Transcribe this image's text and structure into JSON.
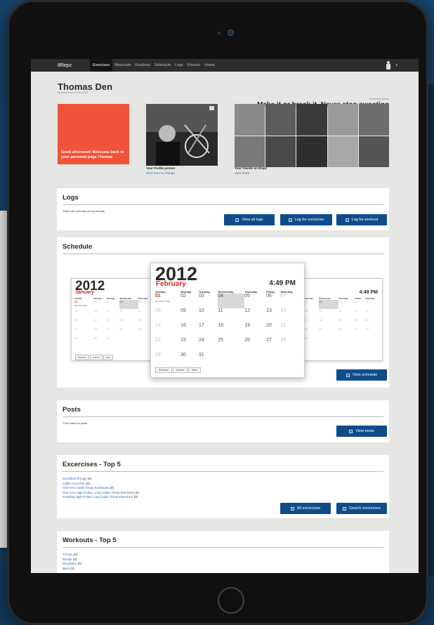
{
  "app": {
    "brand": "8Repz"
  },
  "nav": [
    "Exercises",
    "Workouts",
    "Routines",
    "Schedule",
    "Logs",
    "Friends",
    "Home"
  ],
  "nav_active": "Exercises",
  "profile": {
    "name": "Thomas Den",
    "since": "Member Since 12 Dec 2012",
    "quote_label": "Personal Quote",
    "quote": "Make it or break it. Never stop sweating"
  },
  "welcome": "Good afternoon! Welcome back to your personal page Thomas",
  "profile_pic": {
    "caption": "Your Profile picture",
    "link": "Click here to change"
  },
  "friends": {
    "caption": "Your friends on 8repz",
    "link": "View more"
  },
  "logs": {
    "title": "Logs",
    "text": "There are currently no log records",
    "btn_view": "View all logs",
    "btn_exercise": "Log for excercise",
    "btn_workout": "Log for workout"
  },
  "schedule": {
    "title": "Schedule",
    "btn_view": "View schedule",
    "front": {
      "year": "2012",
      "month": "February",
      "time": "4:49 PM",
      "days": [
        "Sunday",
        "Monday",
        "Tuesday",
        "Wednesday",
        "Thursday",
        "Friday",
        "Saturday"
      ],
      "note": "New Year's Day",
      "nav": [
        "Previous",
        "Current",
        "Next"
      ],
      "weeks": [
        [
          "01",
          "02",
          "03",
          "04",
          "05",
          "06",
          "07"
        ],
        [
          "08",
          "09",
          "10",
          "11",
          "12",
          "13",
          "14"
        ],
        [
          "15",
          "16",
          "17",
          "18",
          "19",
          "20",
          "21"
        ],
        [
          "22",
          "23",
          "24",
          "25",
          "26",
          "27",
          "28"
        ],
        [
          "29",
          "30",
          "31",
          "",
          "",
          "",
          ""
        ]
      ]
    },
    "left": {
      "year": "2012",
      "month": "January",
      "days": [
        "Sunday",
        "Monday",
        "Tuesday",
        "Wednesday",
        "Thursday"
      ],
      "note": "New Year's Day",
      "nav": [
        "Previous",
        "Current",
        "Next"
      ],
      "weeks": [
        [
          "01",
          "02",
          "03",
          "04",
          "05"
        ],
        [
          "08",
          "09",
          "10",
          "11",
          "12"
        ],
        [
          "15",
          "16",
          "17",
          "18",
          "19"
        ],
        [
          "22",
          "23",
          "24",
          "25",
          "26"
        ],
        [
          "29",
          "30",
          "31",
          "",
          ""
        ]
      ]
    },
    "right": {
      "year": "2",
      "time": "4:49 PM",
      "days": [
        "Tuesday",
        "Wednesday",
        "Thursday",
        "Friday",
        "Saturday"
      ],
      "weeks": [
        [
          "03",
          "04",
          "05",
          "06",
          "07"
        ],
        [
          "10",
          "11",
          "12",
          "13",
          "14"
        ],
        [
          "17",
          "18",
          "19",
          "20",
          "21"
        ],
        [
          "24",
          "25",
          "26",
          "27",
          "28"
        ],
        [
          "31",
          "",
          "",
          "",
          ""
        ]
      ]
    }
  },
  "posts": {
    "title": "Posts",
    "text": "YYou have no posts",
    "btn_view": "View posts"
  },
  "exercises": {
    "title": "Excercises - Top 5",
    "items": [
      {
        "name": "Dumbbell Shrugs",
        "count": "(0)"
      },
      {
        "name": "Cable Crunches",
        "count": "(0)"
      },
      {
        "name": "One-Arm Cable Tricep Kickbacks",
        "count": "(0)"
      },
      {
        "name": "One-Arm High-Pulley, Long Cable Tricep Etensions",
        "count": "(0)"
      },
      {
        "name": "Kneeling High Pulley Long Cable Tricep Etensions",
        "count": "(0)"
      }
    ],
    "btn_all": "All excercises",
    "btn_search": "Search excercises"
  },
  "workouts": {
    "title": "Workouts - Top 5",
    "items": [
      {
        "name": "Triceps",
        "count": "(0)"
      },
      {
        "name": "Biceps",
        "count": "(0)"
      },
      {
        "name": "Shoulders",
        "count": "(0)"
      },
      {
        "name": "Back",
        "count": "(0)"
      }
    ]
  }
}
